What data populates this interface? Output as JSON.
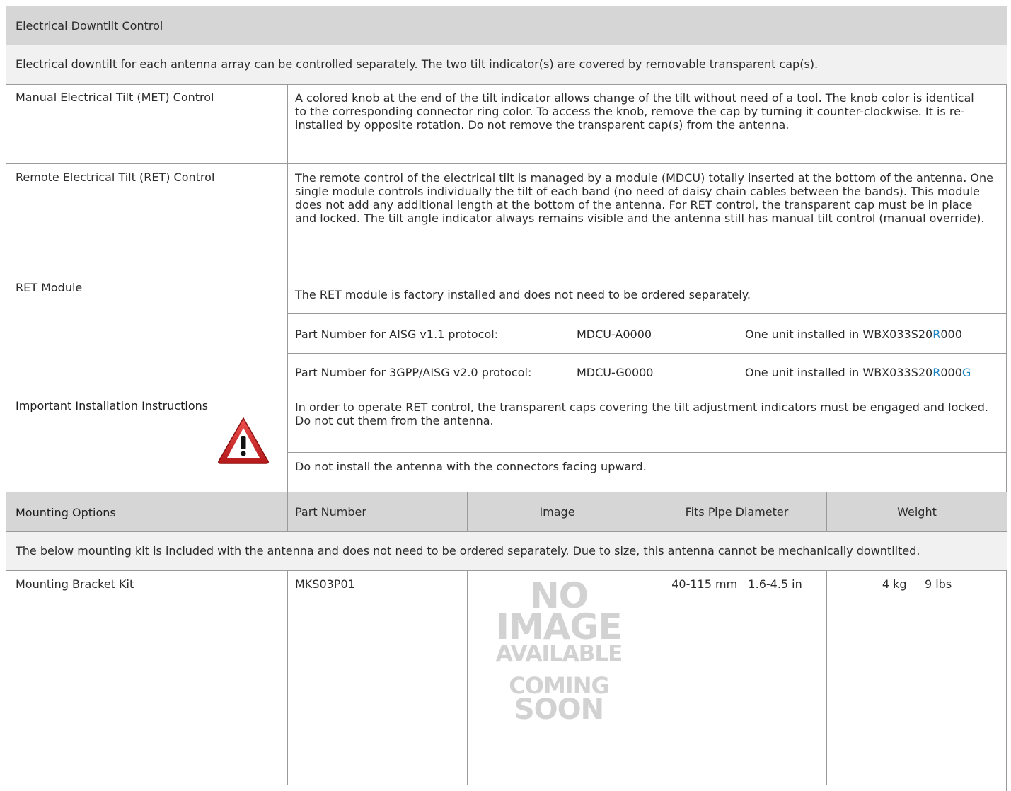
{
  "section_title": "Electrical Downtilt Control",
  "intro": "Electrical downtilt for each antenna array can be controlled separately.  The two tilt indicator(s) are covered by removable transparent cap(s).",
  "met": {
    "label": "Manual Electrical Tilt (MET) Control",
    "text": "A colored knob at the end of the tilt indicator allows change of the tilt without need of a tool.  The knob color is identical to the corresponding connector ring color.  To access the knob, remove the cap by turning it counter-clockwise.  It is re-installed by opposite rotation.  Do not remove the transparent cap(s) from the antenna."
  },
  "ret": {
    "label": "Remote Electrical Tilt (RET) Control",
    "text": "The remote control of the electrical tilt is managed by a module (MDCU) totally inserted at the bottom of the antenna.  One single module controls individually the tilt of each band (no need of daisy chain cables between the bands).  This module does not add any additional length at the bottom of the antenna.  For RET control, the transparent cap must be in place and locked.  The tilt angle indicator always remains visible and the antenna still has manual tilt control (manual override)."
  },
  "ret_module": {
    "label": "RET Module",
    "text": "The RET module is factory installed and does not need to be ordered separately.",
    "parts": [
      {
        "protocol": "Part Number for AISG v1.1 protocol:",
        "part": "MDCU-A0000",
        "unit_prefix": "One unit installed in WBX033S20",
        "unit_r": "R",
        "unit_suffix": "000",
        "unit_g": ""
      },
      {
        "protocol": "Part Number for 3GPP/AISG v2.0 protocol:",
        "part": "MDCU-G0000",
        "unit_prefix": "One unit installed in WBX033S20",
        "unit_r": "R",
        "unit_suffix": "000",
        "unit_g": "G"
      }
    ]
  },
  "install": {
    "label": "Important Installation Instructions",
    "icon": "warning-icon",
    "text1": "In order to operate RET control, the transparent caps covering the tilt adjustment indicators must be engaged and locked.  Do not cut them from the antenna.",
    "text2": "Do not install the antenna with the connectors facing upward."
  },
  "mounting": {
    "label": "Mounting Options",
    "headers": [
      "Part Number",
      "Image",
      "Fits Pipe Diameter",
      "Weight"
    ],
    "note": "The below mounting kit is included with the antenna and does not need to be ordered separately.  Due to size, this antenna cannot be mechanically downtilted.",
    "kit": {
      "name": "Mounting Bracket Kit",
      "part": "MKS03P01",
      "pipe": "40-115 mm   1.6-4.5 in",
      "weight": "4 kg     9 lbs"
    },
    "placeholder": {
      "line1": "NO",
      "line2": "IMAGE",
      "line3": "AVAILABLE",
      "line4": "COMING",
      "line5": "SOON"
    }
  },
  "colors": {
    "header_bg": "#d6d6d6",
    "note_bg": "#f1f1f1",
    "accent_blue": "#1a82c4",
    "warning_red": "#d62a2a"
  }
}
